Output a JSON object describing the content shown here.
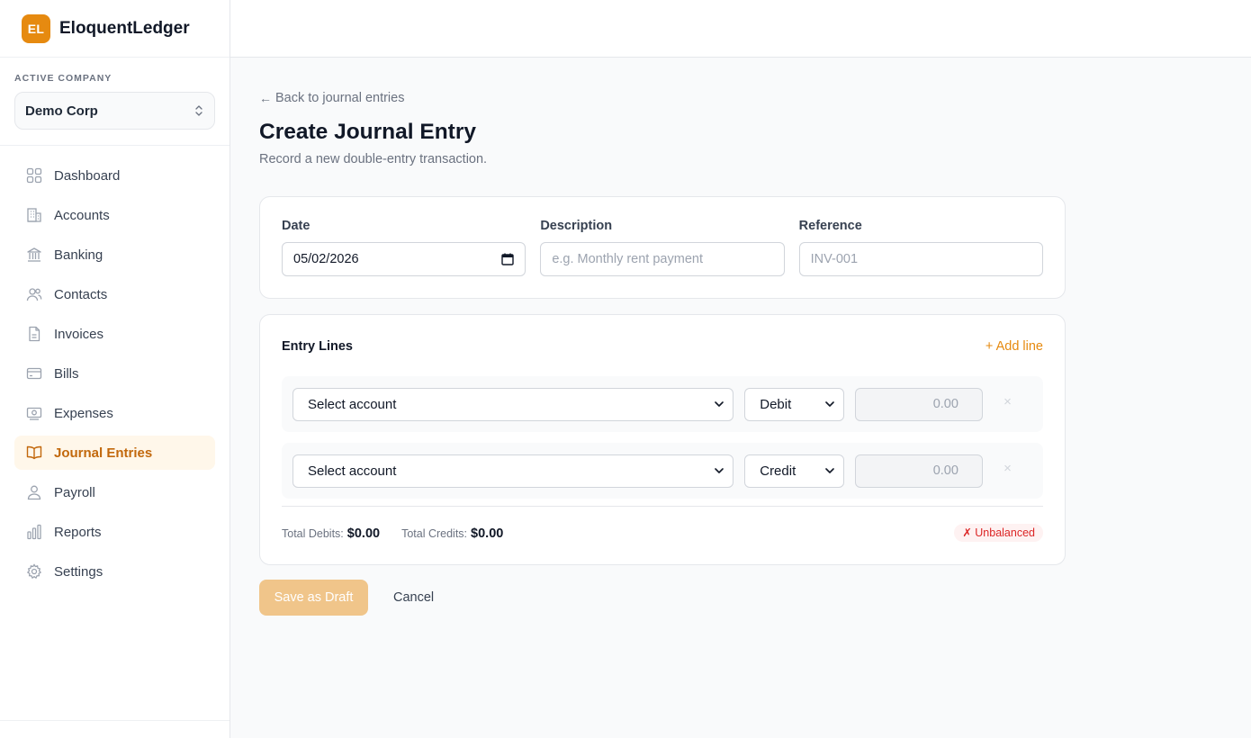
{
  "brand": {
    "logo_text": "EL",
    "name": "EloquentLedger",
    "accent": "#e68a10"
  },
  "company": {
    "label": "ACTIVE COMPANY",
    "selected": "Demo Corp"
  },
  "nav": {
    "items": [
      {
        "label": "Dashboard",
        "icon": "grid-icon"
      },
      {
        "label": "Accounts",
        "icon": "building-icon"
      },
      {
        "label": "Banking",
        "icon": "bank-icon"
      },
      {
        "label": "Contacts",
        "icon": "users-icon"
      },
      {
        "label": "Invoices",
        "icon": "document-icon"
      },
      {
        "label": "Bills",
        "icon": "credit-card-icon"
      },
      {
        "label": "Expenses",
        "icon": "cash-icon"
      },
      {
        "label": "Journal Entries",
        "icon": "book-icon",
        "active": true
      },
      {
        "label": "Payroll",
        "icon": "user-icon"
      },
      {
        "label": "Reports",
        "icon": "bar-chart-icon"
      },
      {
        "label": "Settings",
        "icon": "gear-icon"
      }
    ]
  },
  "page": {
    "back_link": "Back to journal entries",
    "back_arrow": "←",
    "title": "Create Journal Entry",
    "subtitle": "Record a new double-entry transaction."
  },
  "form": {
    "date": {
      "label": "Date",
      "value": "05/02/2026"
    },
    "description": {
      "label": "Description",
      "placeholder": "e.g. Monthly rent payment"
    },
    "reference": {
      "label": "Reference",
      "placeholder": "INV-001"
    }
  },
  "lines": {
    "title": "Entry Lines",
    "add_label": "+ Add line",
    "rows": [
      {
        "account": "Select account",
        "type": "Debit",
        "amount": "0.00",
        "remove": "×"
      },
      {
        "account": "Select account",
        "type": "Credit",
        "amount": "0.00",
        "remove": "×"
      }
    ],
    "totals": {
      "debits_label": "Total Debits:",
      "debits_value": "$0.00",
      "credits_label": "Total Credits:",
      "credits_value": "$0.00",
      "status": "✗ Unbalanced"
    }
  },
  "actions": {
    "save_label": "Save as Draft",
    "cancel_label": "Cancel"
  }
}
